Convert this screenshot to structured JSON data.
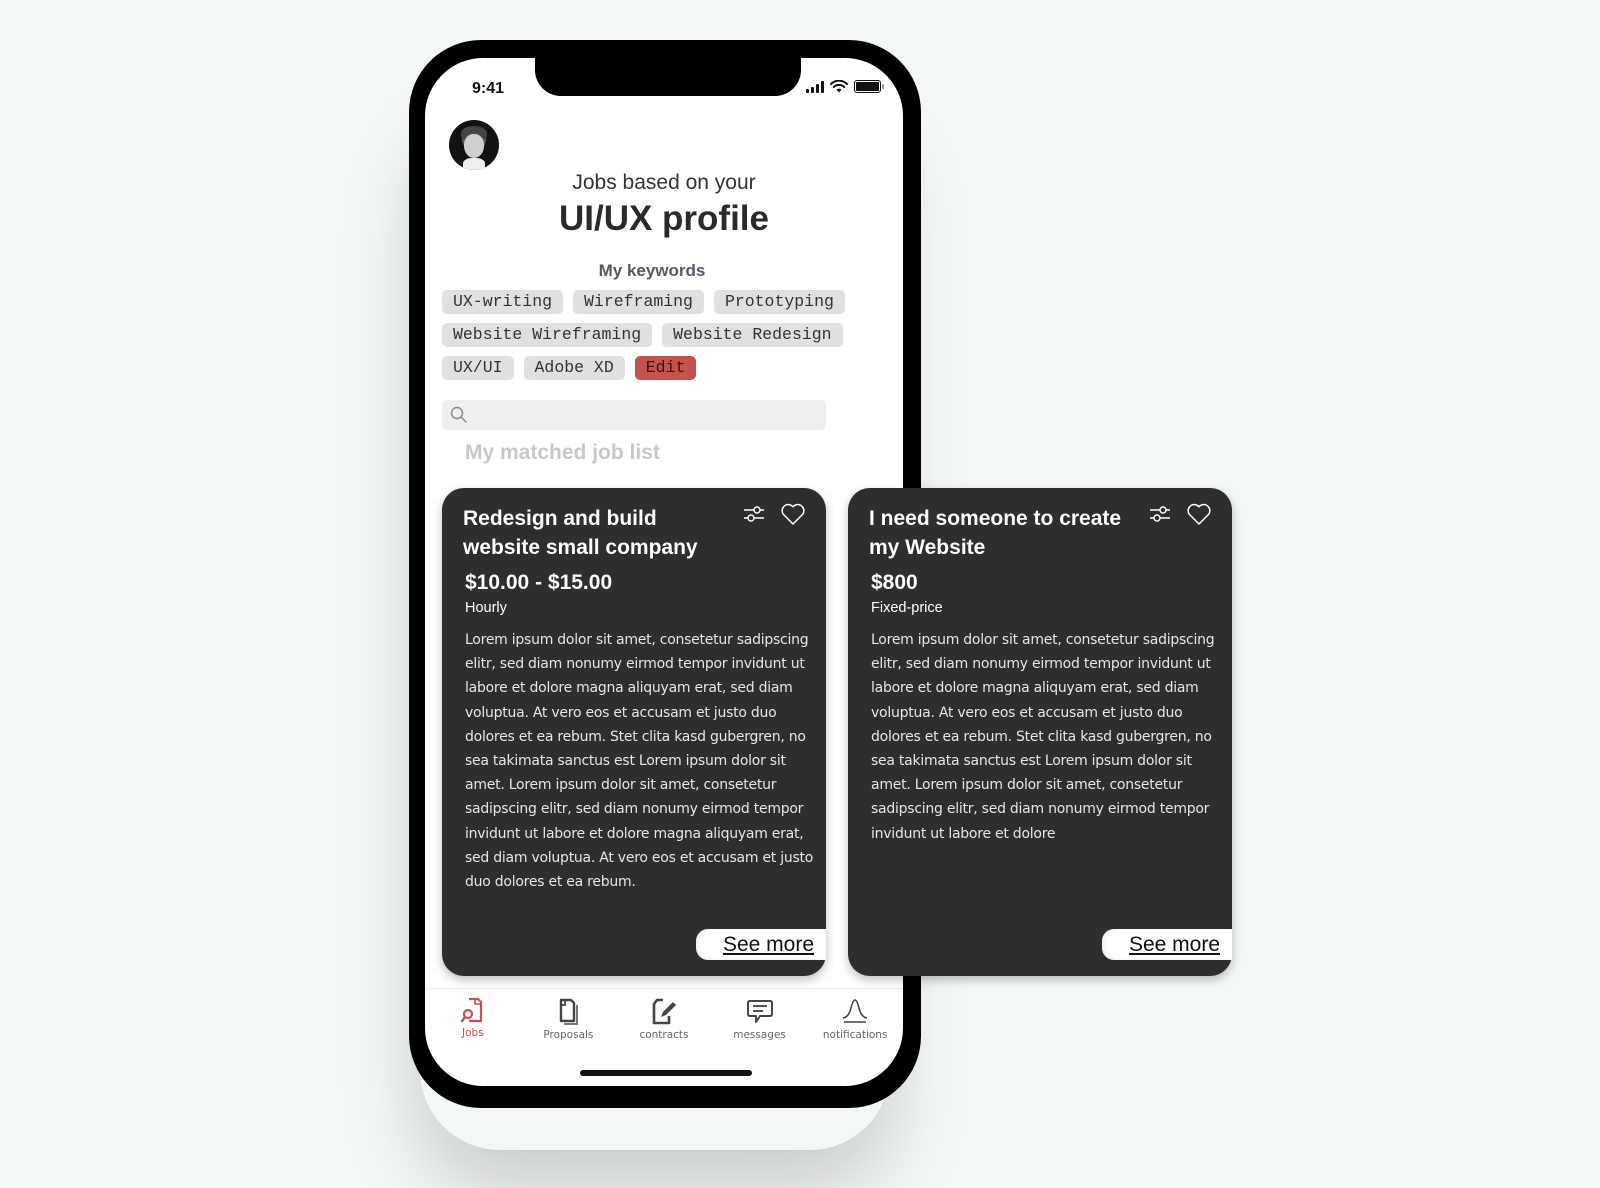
{
  "status_bar": {
    "time": "9:41",
    "icons": [
      "signal-icon",
      "wifi-icon",
      "battery-icon"
    ]
  },
  "header": {
    "avatar": "profile-avatar",
    "subtitle": "Jobs based on your",
    "title": "UI/UX profile"
  },
  "keywords": {
    "heading": "My keywords",
    "items": [
      "UX-writing",
      "Wireframing",
      "Prototyping",
      "Website Wireframing",
      "Website Redesign",
      "UX/UI",
      "Adobe XD"
    ],
    "edit_label": "Edit",
    "edit_color": "#c4524f"
  },
  "search": {
    "placeholder": "",
    "value": "",
    "icon": "search-icon"
  },
  "job_list": {
    "heading": "My matched job list",
    "jobs": [
      {
        "title": "Redesign and build website small company",
        "price": "$10.00 - $15.00",
        "price_type": "Hourly",
        "description": "Lorem ipsum dolor sit amet, consetetur sadipscing elitr, sed diam nonumy eirmod tempor invidunt ut labore et dolore magna aliquyam erat, sed diam voluptua. At vero eos et accusam et justo duo dolores et ea rebum. Stet clita kasd gubergren, no sea takimata sanctus est Lorem ipsum dolor sit amet. Lorem ipsum dolor sit amet, consetetur sadipscing elitr, sed diam nonumy eirmod tempor invidunt ut labore et dolore magna aliquyam erat, sed diam voluptua. At vero eos et accusam et justo duo dolores et ea rebum.",
        "see_more": "See more"
      },
      {
        "title": "I need someone to create my Website",
        "price": "$800",
        "price_type": "Fixed-price",
        "description": "Lorem ipsum dolor sit amet, consetetur sadipscing elitr, sed diam nonumy eirmod tempor invidunt ut labore et dolore magna aliquyam erat, sed diam voluptua. At vero eos et accusam et justo duo dolores et ea rebum. Stet clita kasd gubergren, no sea takimata sanctus est Lorem ipsum dolor sit amet. Lorem ipsum dolor sit amet, consetetur sadipscing elitr, sed diam nonumy eirmod tempor invidunt ut labore et dolore",
        "see_more": "See more"
      }
    ]
  },
  "tab_bar": {
    "active_color": "#c4524f",
    "tabs": [
      {
        "label": "Jobs",
        "icon": "jobs-icon",
        "active": true
      },
      {
        "label": "Proposals",
        "icon": "proposals-icon",
        "active": false
      },
      {
        "label": "contracts",
        "icon": "contracts-icon",
        "active": false
      },
      {
        "label": "messages",
        "icon": "messages-icon",
        "active": false
      },
      {
        "label": "notifications",
        "icon": "notifications-icon",
        "active": false
      }
    ]
  }
}
